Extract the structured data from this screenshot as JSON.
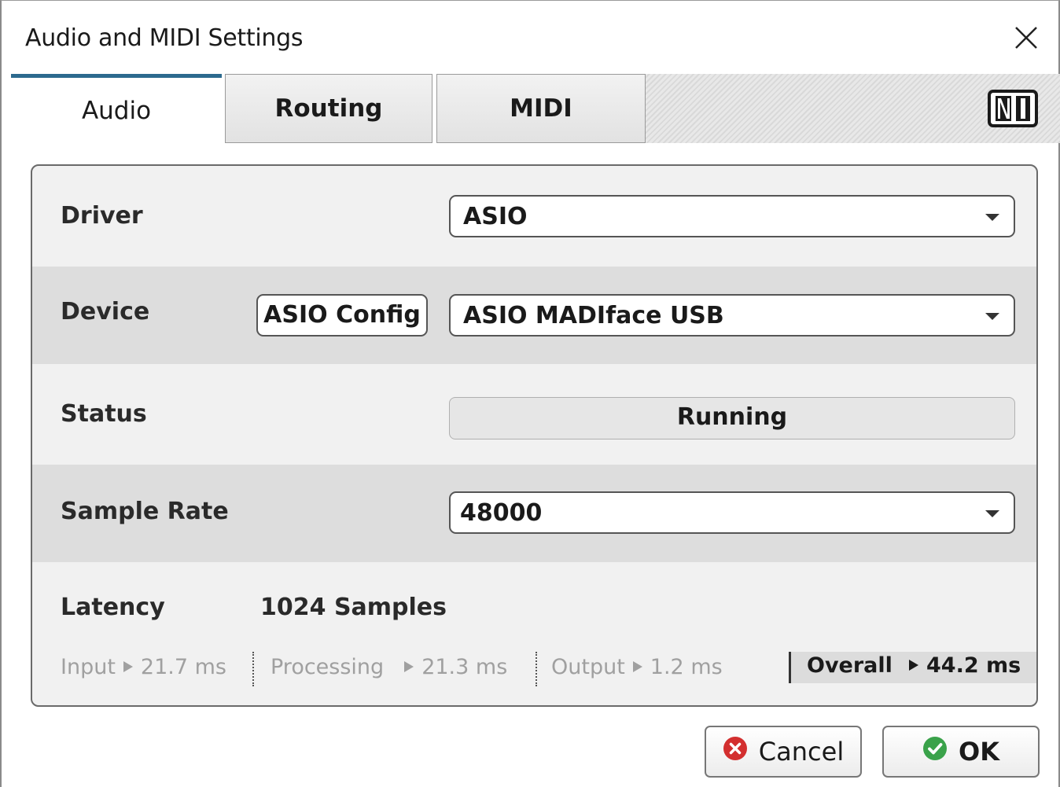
{
  "window": {
    "title": "Audio and MIDI Settings",
    "close_icon": "close-icon"
  },
  "tabs": [
    {
      "label": "Audio",
      "active": true
    },
    {
      "label": "Routing",
      "active": false
    },
    {
      "label": "MIDI",
      "active": false
    }
  ],
  "brand": {
    "logo": "NI",
    "accent_color": "#2c6a8e"
  },
  "settings": {
    "driver": {
      "label": "Driver",
      "value": "ASIO"
    },
    "device": {
      "label": "Device",
      "config_button": "ASIO Config",
      "value": "ASIO MADIface USB"
    },
    "status": {
      "label": "Status",
      "value": "Running"
    },
    "sample_rate": {
      "label": "Sample Rate",
      "value": "48000"
    },
    "latency": {
      "label": "Latency",
      "value": "1024 Samples",
      "input_label": "Input",
      "input_value": "21.7 ms",
      "processing_label": "Processing",
      "processing_value": "21.3 ms",
      "output_label": "Output",
      "output_value": "1.2 ms",
      "overall_label": "Overall",
      "overall_value": "44.2 ms"
    }
  },
  "footer": {
    "cancel_label": "Cancel",
    "ok_label": "OK",
    "cancel_icon_color": "#d32f2f",
    "ok_icon_color": "#3aa24a"
  }
}
